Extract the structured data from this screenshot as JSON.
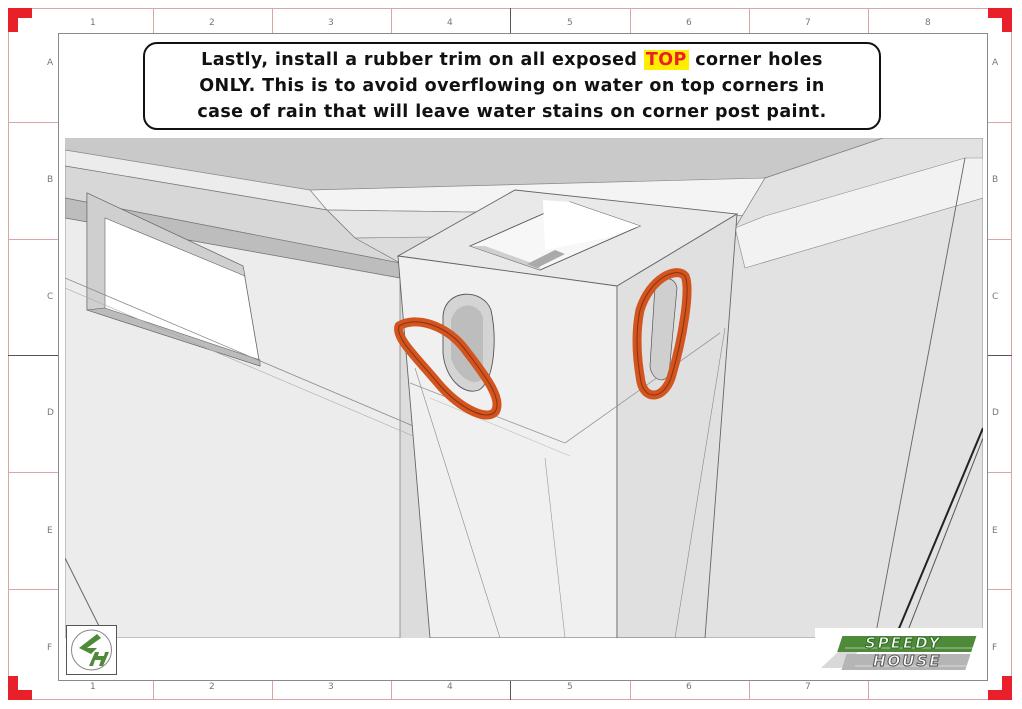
{
  "sheet": {
    "columns_top": [
      "1",
      "2",
      "3",
      "4",
      "5",
      "6",
      "7",
      "8"
    ],
    "columns_bottom": [
      "1",
      "2",
      "3",
      "4",
      "5",
      "6",
      "7"
    ],
    "rows": [
      "A",
      "B",
      "C",
      "D",
      "E",
      "F"
    ]
  },
  "callout": {
    "line1_before": "Lastly, install a rubber trim on all exposed ",
    "highlight": "TOP",
    "line1_after": " corner holes",
    "line2": "ONLY. This is to avoid overflowing on water on top corners in",
    "line3": "case of rain that will leave water stains on corner post paint."
  },
  "logos": {
    "sh_monogram": "SH",
    "speedy_word1": "SPEEDY",
    "speedy_word2": "HOUSE"
  },
  "colors": {
    "frame_accent": "#e8202a",
    "highlight_bg": "#ffee00",
    "rubber_trim": "#d2541f",
    "logo_green": "#4e8a3a"
  },
  "icons": {
    "sh_logo": "sh-monogram-icon",
    "speedy_logo": "speedy-house-logo-icon"
  }
}
